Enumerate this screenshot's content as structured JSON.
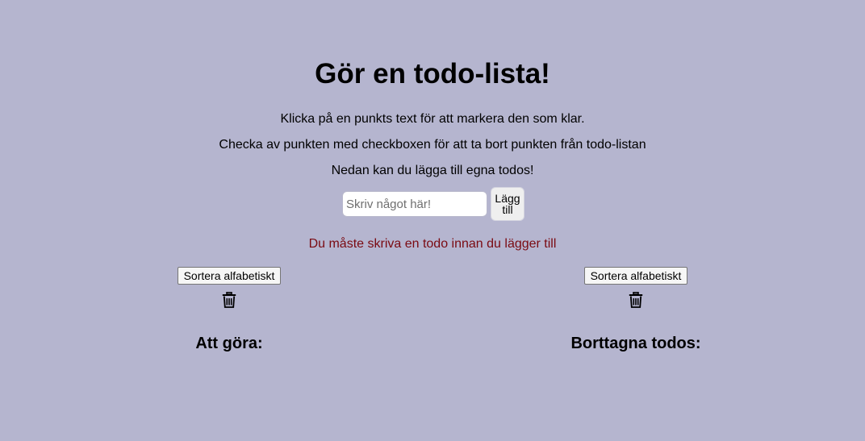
{
  "header": {
    "title": "Gör en todo-lista!"
  },
  "instructions": [
    "Klicka på en punkts text för att markera den som klar.",
    "Checka av punkten med checkboxen för att ta bort punkten från todo-listan",
    "Nedan kan du lägga till egna todos!"
  ],
  "form": {
    "input_value": "",
    "input_placeholder": "Skriv något här!",
    "add_label": "Lägg till",
    "error": "Du måste skriva en todo innan du lägger till"
  },
  "lists": {
    "todo": {
      "sort_label": "Sortera alfabetiskt",
      "heading": "Att göra:",
      "trash_icon": "trash-icon",
      "items": []
    },
    "removed": {
      "sort_label": "Sortera alfabetiskt",
      "heading": "Borttagna todos:",
      "trash_icon": "trash-icon",
      "items": []
    }
  },
  "colors": {
    "background": "#b5b5cf",
    "error_text": "#7a0a12"
  }
}
